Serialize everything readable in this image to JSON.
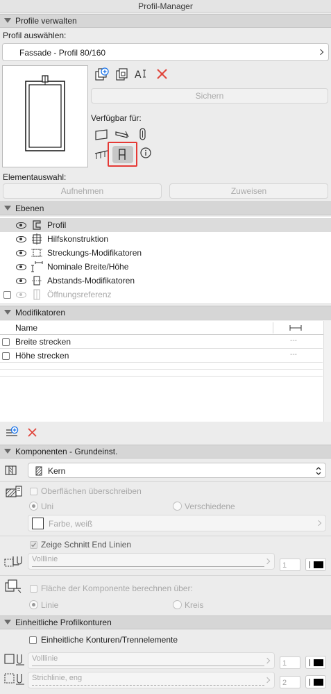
{
  "window": {
    "title": "Profil-Manager"
  },
  "profile_section": {
    "header": "Profile verwalten",
    "select_label": "Profil auswählen:",
    "selected_profile": "Fassade - Profil 80/160",
    "save_button": "Sichern",
    "available_for_label": "Verfügbar für:",
    "element_selection_label": "Elementauswahl:",
    "pick_button": "Aufnehmen",
    "assign_button": "Zuweisen"
  },
  "layers_section": {
    "header": "Ebenen",
    "items": [
      {
        "label": "Profil",
        "checkbox": false
      },
      {
        "label": "Hilfskonstruktion",
        "checkbox": false
      },
      {
        "label": "Streckungs-Modifikatoren",
        "checkbox": false
      },
      {
        "label": "Nominale Breite/Höhe",
        "checkbox": false
      },
      {
        "label": "Abstands-Modifikatoren",
        "checkbox": false
      },
      {
        "label": "Öffnungsreferenz",
        "checkbox": true
      }
    ]
  },
  "modifiers_section": {
    "header": "Modifikatoren",
    "column_name": "Name",
    "rows": [
      {
        "name": "Breite strecken",
        "value": "---"
      },
      {
        "name": "Höhe strecken",
        "value": "---"
      }
    ]
  },
  "components_section": {
    "header": "Komponenten - Grundeinst.",
    "component": "Kern",
    "override_surfaces": "Oberflächen überschreiben",
    "radio_uniform": "Uni",
    "radio_different": "Verschiedene",
    "surface_value": "Farbe, weiß",
    "show_cut_end_lines": "Zeige Schnitt End Linien",
    "line_type": "Volllinie",
    "line_pen": "1",
    "calc_area_label": "Fläche der Komponente berechnen über:",
    "radio_line": "Linie",
    "radio_circle": "Kreis"
  },
  "contours_section": {
    "header": "Einheitliche Profilkonturen",
    "uniform_contours": "Einheitliche Konturen/Trennelemente",
    "outline_line": "Volllinie",
    "outline_pen": "1",
    "separator_line": "Strichlinie, eng",
    "separator_pen": "2"
  },
  "colors": {
    "accent_blue": "#1a73e8",
    "delete_red": "#e0443a",
    "highlight_red": "#e53935"
  }
}
